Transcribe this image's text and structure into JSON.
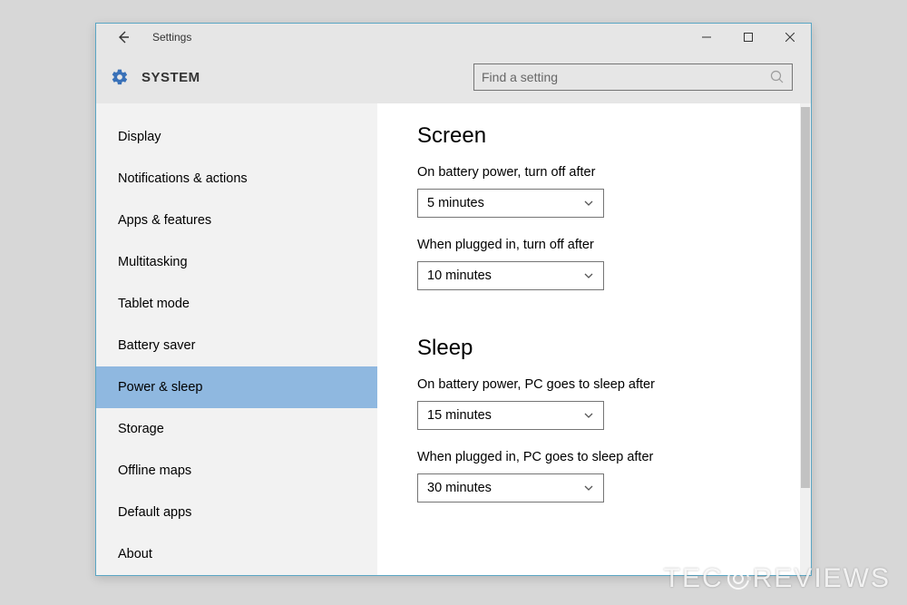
{
  "window": {
    "title": "Settings",
    "app_label": "SYSTEM"
  },
  "search": {
    "placeholder": "Find a setting"
  },
  "sidebar": {
    "items": [
      {
        "label": "Display",
        "active": false
      },
      {
        "label": "Notifications & actions",
        "active": false
      },
      {
        "label": "Apps & features",
        "active": false
      },
      {
        "label": "Multitasking",
        "active": false
      },
      {
        "label": "Tablet mode",
        "active": false
      },
      {
        "label": "Battery saver",
        "active": false
      },
      {
        "label": "Power & sleep",
        "active": true
      },
      {
        "label": "Storage",
        "active": false
      },
      {
        "label": "Offline maps",
        "active": false
      },
      {
        "label": "Default apps",
        "active": false
      },
      {
        "label": "About",
        "active": false
      }
    ]
  },
  "content": {
    "screen": {
      "heading": "Screen",
      "battery_label": "On battery power, turn off after",
      "battery_value": "5 minutes",
      "plugged_label": "When plugged in, turn off after",
      "plugged_value": "10 minutes"
    },
    "sleep": {
      "heading": "Sleep",
      "battery_label": "On battery power, PC goes to sleep after",
      "battery_value": "15 minutes",
      "plugged_label": "When plugged in, PC goes to sleep after",
      "plugged_value": "30 minutes"
    }
  },
  "watermark": {
    "prefix": "TEC",
    "suffix": "REVIEWS"
  }
}
